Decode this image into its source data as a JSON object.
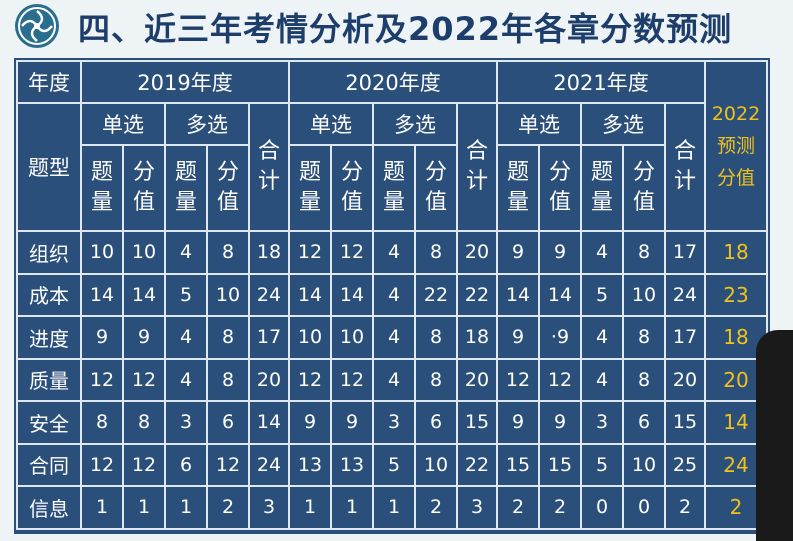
{
  "header": {
    "title": "四、近三年考情分析及2022年各章分数预测"
  },
  "table": {
    "corner": "年度",
    "type_label": "题型",
    "years": [
      "2019年度",
      "2020年度",
      "2021年度"
    ],
    "prediction_header": "2022预测分值",
    "single_choice": "单选",
    "multi_choice": "多选",
    "total": "合计",
    "count": "题量",
    "score": "分值",
    "rows": [
      {
        "name": "组织",
        "cells": [
          "10",
          "10",
          "4",
          "8",
          "18",
          "12",
          "12",
          "4",
          "8",
          "20",
          "9",
          "9",
          "4",
          "8",
          "17"
        ],
        "pred": "18"
      },
      {
        "name": "成本",
        "cells": [
          "14",
          "14",
          "5",
          "10",
          "24",
          "14",
          "14",
          "4",
          "22",
          "22",
          "14",
          "14",
          "5",
          "10",
          "24"
        ],
        "pred": "23"
      },
      {
        "name": "进度",
        "cells": [
          "9",
          "9",
          "4",
          "8",
          "17",
          "10",
          "10",
          "4",
          "8",
          "18",
          "9",
          "·9",
          "4",
          "8",
          "17"
        ],
        "pred": "18"
      },
      {
        "name": "质量",
        "cells": [
          "12",
          "12",
          "4",
          "8",
          "20",
          "12",
          "12",
          "4",
          "8",
          "20",
          "12",
          "12",
          "4",
          "8",
          "20"
        ],
        "pred": "20"
      },
      {
        "name": "安全",
        "cells": [
          "8",
          "8",
          "3",
          "6",
          "14",
          "9",
          "9",
          "3",
          "6",
          "15",
          "9",
          "9",
          "3",
          "6",
          "15"
        ],
        "pred": "14"
      },
      {
        "name": "合同",
        "cells": [
          "12",
          "12",
          "6",
          "12",
          "24",
          "13",
          "13",
          "5",
          "10",
          "22",
          "15",
          "15",
          "5",
          "10",
          "25"
        ],
        "pred": "24"
      },
      {
        "name": "信息",
        "cells": [
          "1",
          "1",
          "1",
          "2",
          "3",
          "1",
          "1",
          "1",
          "2",
          "3",
          "2",
          "2",
          "0",
          "0",
          "2"
        ],
        "pred": "2"
      }
    ]
  },
  "colors": {
    "table_bg": "#2a4f7a",
    "prediction": "#f1c21b",
    "title": "#1d3d6b"
  }
}
